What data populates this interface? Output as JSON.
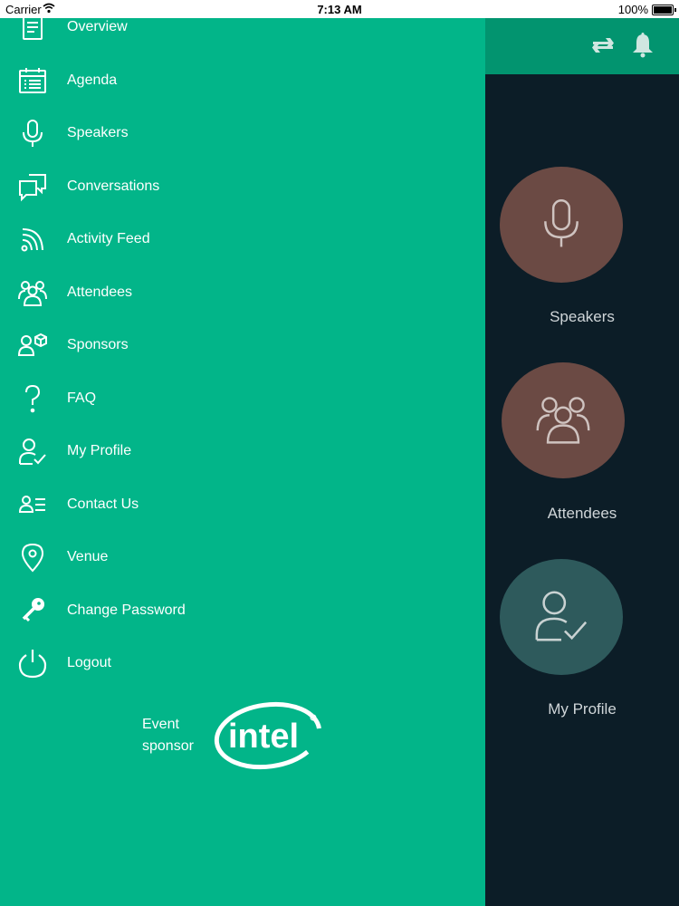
{
  "status_bar": {
    "carrier": "Carrier",
    "time": "7:13 AM",
    "battery": "100%"
  },
  "menu": {
    "items": [
      {
        "label": "Overview",
        "icon": "document-icon"
      },
      {
        "label": "Agenda",
        "icon": "calendar-icon"
      },
      {
        "label": "Speakers",
        "icon": "microphone-icon"
      },
      {
        "label": "Conversations",
        "icon": "chat-bubbles-icon"
      },
      {
        "label": "Activity Feed",
        "icon": "rss-icon"
      },
      {
        "label": "Attendees",
        "icon": "people-group-icon"
      },
      {
        "label": "Sponsors",
        "icon": "person-box-icon"
      },
      {
        "label": "FAQ",
        "icon": "question-icon"
      },
      {
        "label": "My Profile",
        "icon": "person-check-icon"
      },
      {
        "label": "Contact Us",
        "icon": "contact-card-icon"
      },
      {
        "label": "Venue",
        "icon": "location-pin-icon"
      },
      {
        "label": "Change Password",
        "icon": "key-icon"
      },
      {
        "label": "Logout",
        "icon": "power-icon"
      }
    ]
  },
  "sponsor": {
    "line1": "Event",
    "line2": "sponsor",
    "logo_text": "intel"
  },
  "right_pane": {
    "header_icons": [
      "sync-icon",
      "bell-icon"
    ],
    "tiles": [
      {
        "label": "Speakers",
        "icon": "microphone-icon",
        "color": "#6b4a44"
      },
      {
        "label": "Attendees",
        "icon": "people-group-icon",
        "color": "#6b4a44"
      },
      {
        "label": "My Profile",
        "icon": "person-check-icon",
        "color": "#2e5a5c"
      }
    ]
  },
  "colors": {
    "drawer": "#02b589",
    "header": "#02946f",
    "background": "#0c1d27"
  }
}
